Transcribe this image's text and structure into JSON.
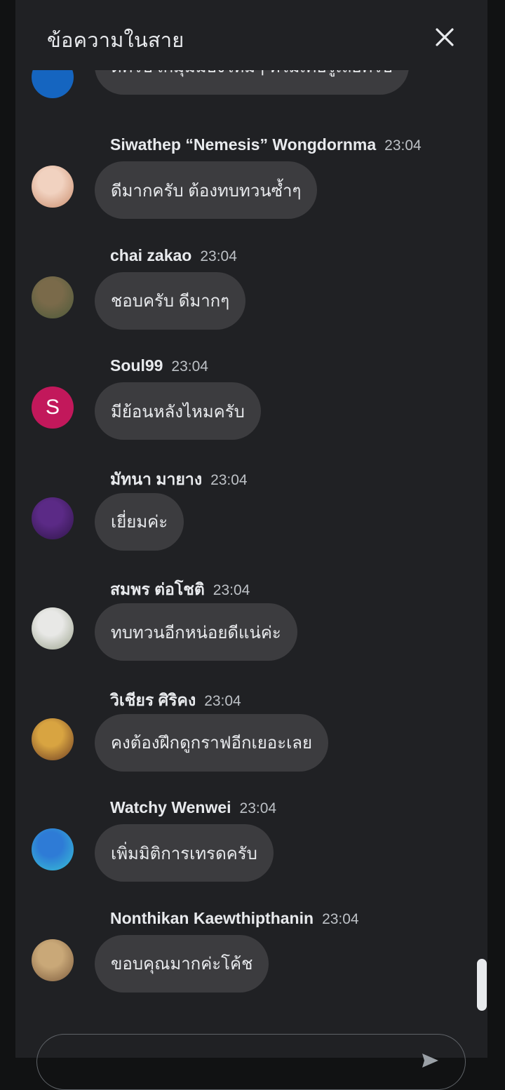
{
  "header": {
    "title": "ข้อความในสาย"
  },
  "partial_message": {
    "text": "ดีครับ เกมุมมองใหม่ๆ ที่ไม่เคยรู้เลยครับ",
    "avatar_color": "#1a73e8"
  },
  "messages": [
    {
      "name": "Siwathep “Nemesis” Wongdornma",
      "time": "23:04",
      "text": "ดีมากครับ ต้องทบทวนซ้ำๆ",
      "avatar": "photo",
      "colors": [
        "#f1d2c0",
        "#c98b6b"
      ]
    },
    {
      "name": "chai zakao",
      "time": "23:04",
      "text": "ชอบครับ ดีมากๆ",
      "avatar": "photo",
      "colors": [
        "#7a6a4a",
        "#4b5a3a"
      ]
    },
    {
      "name": "Soul99",
      "time": "23:04",
      "text": "มีย้อนหลังไหมครับ",
      "avatar": "letter",
      "letter": "S",
      "colors": [
        "#c2185b",
        "#c2185b"
      ]
    },
    {
      "name": "มัทนา มายาง",
      "time": "23:04",
      "text": "เยี่ยมค่ะ",
      "avatar": "photo",
      "colors": [
        "#5b2a86",
        "#2e1547"
      ]
    },
    {
      "name": "สมพร ต่อโชติ",
      "time": "23:04",
      "text": "ทบทวนอีกหน่อยดีแน่ค่ะ",
      "avatar": "photo",
      "colors": [
        "#e8e8e6",
        "#9aa28c"
      ]
    },
    {
      "name": "วิเชียร ศิริคง",
      "time": "23:04",
      "text": "คงต้องฝึกดูกราฟอีกเยอะเลย",
      "avatar": "photo",
      "colors": [
        "#d8a441",
        "#6b3b22"
      ]
    },
    {
      "name": "Watchy Wenwei",
      "time": "23:04",
      "text": "เพิ่มมิติการเทรดครับ",
      "avatar": "photo",
      "colors": [
        "#2e7bd6",
        "#38c3d6"
      ]
    },
    {
      "name": "Nonthikan Kaewthipthanin",
      "time": "23:04",
      "text": "ขอบคุณมากค่ะโค้ช",
      "avatar": "photo",
      "colors": [
        "#c9a878",
        "#7c5b3c"
      ]
    }
  ],
  "icons": {
    "close": "close-icon",
    "send": "send-icon"
  }
}
